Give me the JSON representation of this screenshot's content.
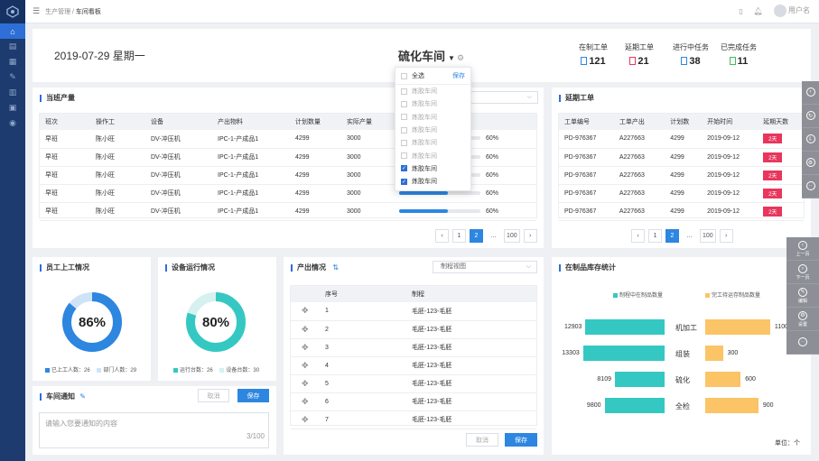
{
  "breadcrumb": {
    "parent": "生产管理",
    "current": "车间看板"
  },
  "user": {
    "name": "用户名"
  },
  "summary": {
    "date": "2019-07-29 星期一",
    "workshop": "硫化车间",
    "stats": [
      {
        "label": "在制工单",
        "value": "121",
        "color": "#2d86e0"
      },
      {
        "label": "延期工单",
        "value": "21",
        "color": "#e8365d"
      },
      {
        "label": "进行中任务",
        "value": "38",
        "color": "#2d86e0"
      },
      {
        "label": "已完成任务",
        "value": "11",
        "color": "#3cbf5a"
      }
    ]
  },
  "dropdown": {
    "select_all": "全选",
    "save": "保存",
    "items": [
      {
        "label": "炼胶车间",
        "checked": false
      },
      {
        "label": "炼胶车间",
        "checked": false
      },
      {
        "label": "炼胶车间",
        "checked": false
      },
      {
        "label": "炼胶车间",
        "checked": false
      },
      {
        "label": "炼胶车间",
        "checked": false
      },
      {
        "label": "炼胶车间",
        "checked": false
      },
      {
        "label": "炼胶车间",
        "checked": true
      },
      {
        "label": "炼胶车间",
        "checked": true
      }
    ]
  },
  "shift": {
    "title": "当班产量",
    "headers": [
      "班次",
      "操作工",
      "设备",
      "产出物料",
      "计划数量",
      "实际产量"
    ],
    "rows": [
      {
        "c": [
          "早班",
          "陈小旺",
          "DV-冲压机",
          "IPC-1-产成品1",
          "4299",
          "3000"
        ],
        "pct": 60,
        "pct_text": "60%"
      },
      {
        "c": [
          "早班",
          "陈小旺",
          "DV-冲压机",
          "IPC-1-产成品1",
          "4299",
          "3000"
        ],
        "pct": 60,
        "pct_text": "60%"
      },
      {
        "c": [
          "早班",
          "陈小旺",
          "DV-冲压机",
          "IPC-1-产成品1",
          "4299",
          "3000"
        ],
        "pct": 60,
        "pct_text": "60%"
      },
      {
        "c": [
          "早班",
          "陈小旺",
          "DV-冲压机",
          "IPC-1-产成品1",
          "4299",
          "3000"
        ],
        "pct": 60,
        "pct_text": "60%"
      },
      {
        "c": [
          "早班",
          "陈小旺",
          "DV-冲压机",
          "IPC-1-产成品1",
          "4299",
          "3000"
        ],
        "pct": 60,
        "pct_text": "60%"
      }
    ],
    "pages": [
      "1",
      "2",
      "...",
      "100"
    ]
  },
  "delay": {
    "title": "延期工单",
    "headers": [
      "工单编号",
      "工单产出",
      "计划数",
      "开始时间",
      "延期天数"
    ],
    "rows": [
      {
        "c": [
          "PD-976367",
          "A227663",
          "4299",
          "2019-09-12"
        ],
        "days": "2天"
      },
      {
        "c": [
          "PD-976367",
          "A227663",
          "4299",
          "2019-09-12"
        ],
        "days": "2天"
      },
      {
        "c": [
          "PD-976367",
          "A227663",
          "4299",
          "2019-09-12"
        ],
        "days": "2天"
      },
      {
        "c": [
          "PD-976367",
          "A227663",
          "4299",
          "2019-09-12"
        ],
        "days": "2天"
      },
      {
        "c": [
          "PD-976367",
          "A227663",
          "4299",
          "2019-09-12"
        ],
        "days": "2天"
      }
    ],
    "pages": [
      "1",
      "2",
      "...",
      "100"
    ]
  },
  "staff": {
    "title": "员工上工情况",
    "percent_text": "86%",
    "percent": 86,
    "color": "#2d86e0",
    "track": "#cfe3f7",
    "legend": [
      {
        "label": "已上工人数：26",
        "color": "#2d86e0"
      },
      {
        "label": "部门人数：29",
        "color": "#cfe3f7"
      }
    ]
  },
  "equipment": {
    "title": "设备运行情况",
    "percent_text": "80%",
    "percent": 80,
    "color": "#35c8c3",
    "track": "#d5f1f0",
    "legend": [
      {
        "label": "运行台数：26",
        "color": "#35c8c3"
      },
      {
        "label": "设备台数：30",
        "color": "#d5f1f0"
      }
    ]
  },
  "notice": {
    "title": "车间通知",
    "cancel": "取消",
    "save": "保存",
    "placeholder": "请输入您要通知的内容",
    "counter": "3/100"
  },
  "output": {
    "title": "产出情况",
    "view": "制程视图",
    "headers": [
      "序号",
      "制程"
    ],
    "rows": [
      {
        "no": "1",
        "proc": "毛胚-123-毛胚"
      },
      {
        "no": "2",
        "proc": "毛胚-123-毛胚"
      },
      {
        "no": "3",
        "proc": "毛胚-123-毛胚"
      },
      {
        "no": "4",
        "proc": "毛胚-123-毛胚"
      },
      {
        "no": "5",
        "proc": "毛胚-123-毛胚"
      },
      {
        "no": "6",
        "proc": "毛胚-123-毛胚"
      },
      {
        "no": "7",
        "proc": "毛胚-123-毛胚"
      }
    ],
    "cancel": "取消",
    "save": "保存"
  },
  "inventory": {
    "title": "在制品库存统计",
    "unit": "单位：个"
  },
  "chart_data": {
    "type": "bar",
    "orientation": "horizontal-butterfly",
    "categories": [
      "机加工",
      "组装",
      "硫化",
      "全检"
    ],
    "series": [
      {
        "name": "制程中在制品数量",
        "values": [
          12903,
          13303,
          8109,
          9800
        ],
        "color": "#35c8c3"
      },
      {
        "name": "完工待运存制品数量",
        "values": [
          1100,
          300,
          600,
          900
        ],
        "color": "#fbc466"
      }
    ]
  },
  "floatbar_top": [
    "‹",
    "↻",
    "⇩",
    "⚙",
    "··"
  ],
  "floatbar_side": [
    {
      "label": "上一页",
      "icon": "‹"
    },
    {
      "label": "下一页",
      "icon": "›"
    },
    {
      "label": "编辑",
      "icon": "✎"
    },
    {
      "label": "设置",
      "icon": "⚙"
    },
    {
      "label": "",
      "icon": "··"
    }
  ]
}
